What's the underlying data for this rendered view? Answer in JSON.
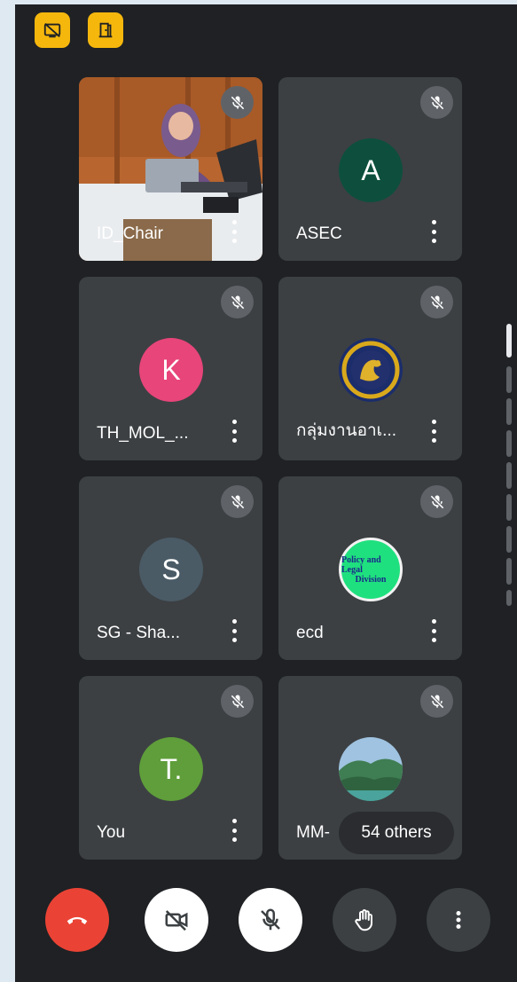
{
  "tiles": [
    {
      "name": "ID_Chair",
      "type": "video"
    },
    {
      "name": "ASEC",
      "initial": "A",
      "color": "#0d4f3c"
    },
    {
      "name": "TH_MOL_...",
      "initial": "K",
      "color": "#e8457a"
    },
    {
      "name": "กลุ่มงานอาเ...",
      "type": "emblem"
    },
    {
      "name": "SG - Sha...",
      "initial": "S",
      "color": "#4a5b66"
    },
    {
      "name": "ecd",
      "logo_text": [
        "Policy and Legal",
        "Division"
      ]
    },
    {
      "name": "You",
      "initial": "T.",
      "color": "#5f9e3a"
    },
    {
      "name": "MM-",
      "type": "landscape"
    }
  ],
  "others_label": "54 others",
  "controls": {
    "end_call": {
      "icon": "phone-hangup-icon",
      "color": "#ea4335"
    },
    "camera": {
      "icon": "camera-off-icon",
      "color": "#ffffff"
    },
    "mic": {
      "icon": "mic-off-icon",
      "color": "#ffffff"
    },
    "raise_hand": {
      "icon": "hand-icon",
      "color": "#3c4043"
    },
    "more": {
      "icon": "more-vert-icon",
      "color": "#3c4043"
    }
  },
  "top_icons": [
    "screen-share-off-icon",
    "door-icon"
  ],
  "accent": "#f6b70d"
}
